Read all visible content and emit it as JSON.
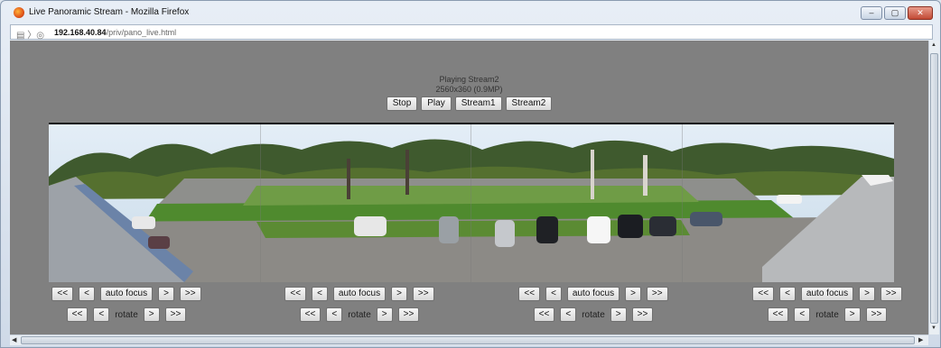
{
  "window": {
    "title": "Live Panoramic Stream - Mozilla Firefox",
    "min_label": "–",
    "max_label": "▢",
    "close_label": "✕"
  },
  "urlbar": {
    "host": "192.168.40.84",
    "path": "/priv/pano_live.html"
  },
  "status": {
    "line1": "Playing Stream2",
    "line2": "2560x360 (0.9MP)"
  },
  "main_buttons": {
    "stop": "Stop",
    "play": "Play",
    "stream1": "Stream1",
    "stream2": "Stream2"
  },
  "controls": {
    "fast_back": "<<",
    "back": "<",
    "auto_focus": "auto focus",
    "forward": ">",
    "fast_forward": ">>",
    "rotate": "rotate"
  },
  "colors": {
    "page_background": "#808080",
    "sky": "#d8e8f4",
    "grass": "#4f8a2e",
    "pavement": "#8c8a86"
  }
}
